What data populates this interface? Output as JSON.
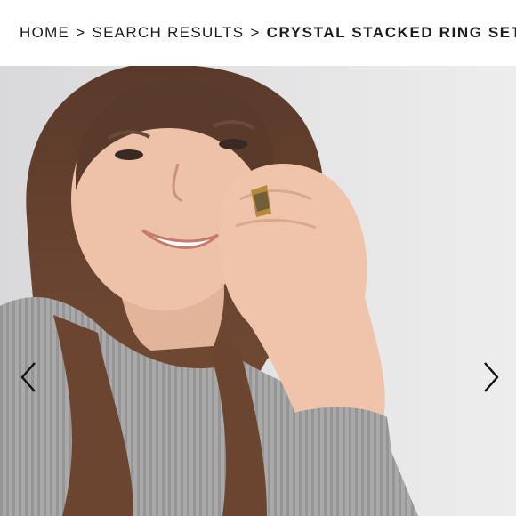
{
  "breadcrumb": {
    "home": "HOME",
    "search_results": "SEARCH RESULTS",
    "current": "CRYSTAL STACKED RING SET",
    "separator": ">"
  },
  "gallery": {
    "image_alt": "",
    "prev_icon": "chevron-left-icon",
    "next_icon": "chevron-right-icon"
  },
  "colors": {
    "text": "#1a1a1a",
    "background": "#ffffff",
    "photo_backdrop": "#e7e7e8",
    "arrow": "#111111"
  }
}
